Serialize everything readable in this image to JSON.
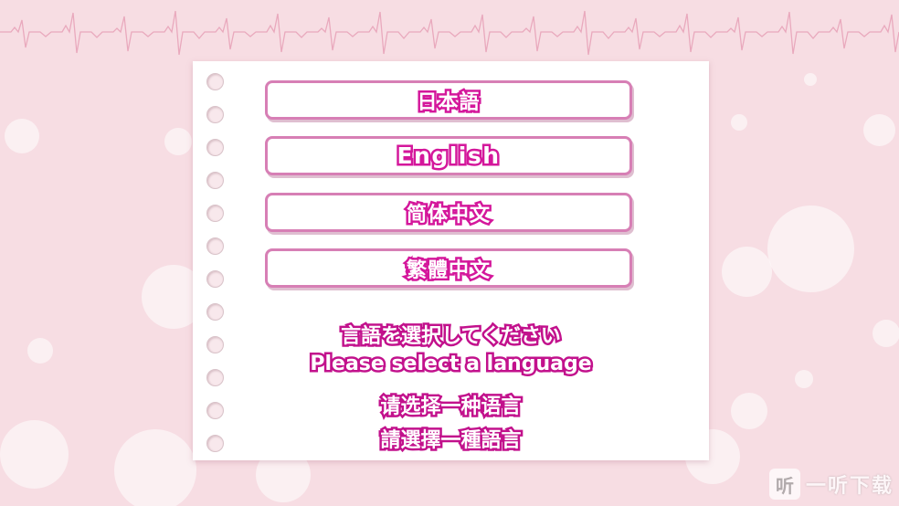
{
  "languages": [
    {
      "label": "日本語"
    },
    {
      "label": "English"
    },
    {
      "label": "简体中文"
    },
    {
      "label": "繁體中文"
    }
  ],
  "prompts": {
    "ja": "言語を選択してください",
    "en": "Please select a language",
    "zh_hans": "请选择一种语言",
    "zh_hant": "請選擇一種語言"
  },
  "watermark": {
    "logo_glyph": "听",
    "text": "一听下载"
  },
  "colors": {
    "background": "#f7dde3",
    "button_border": "#d77fb5",
    "text_outline": "#d4179b",
    "ecg_line": "#e9a9bd"
  }
}
